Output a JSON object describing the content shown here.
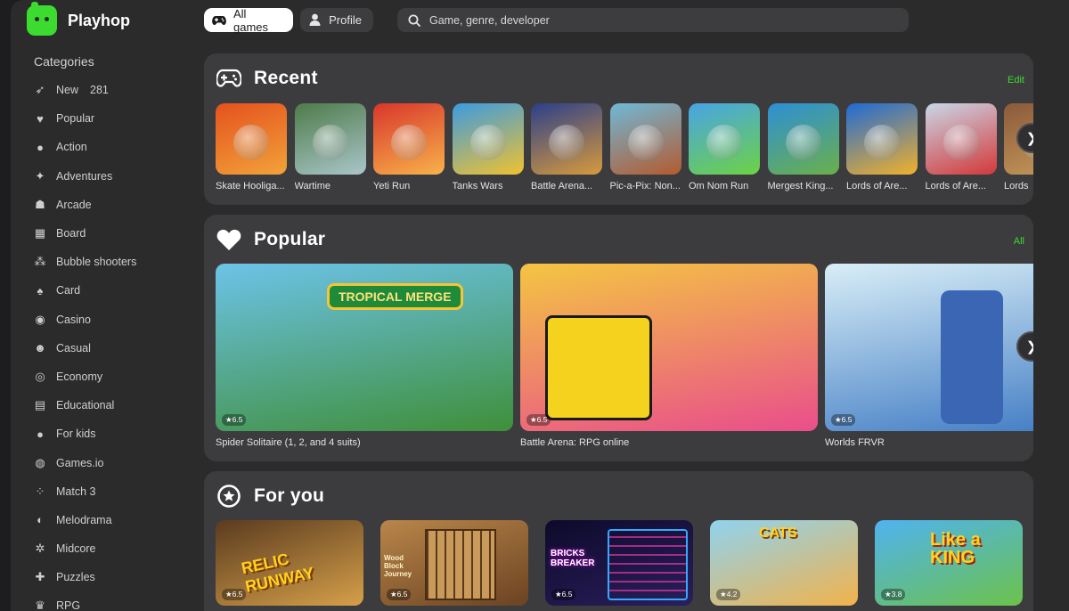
{
  "app": {
    "name": "Playhop"
  },
  "header": {
    "tabs": [
      {
        "label": "All games",
        "icon": "gamepad-icon",
        "active": true
      },
      {
        "label": "Profile",
        "icon": "profile-icon",
        "active": false
      }
    ],
    "search": {
      "placeholder": "Game, genre, developer",
      "icon": "search-icon"
    }
  },
  "sidebar": {
    "title": "Categories",
    "items": [
      {
        "label": "New",
        "count": "281",
        "icon": "rocket-icon"
      },
      {
        "label": "Popular",
        "icon": "heart-icon"
      },
      {
        "label": "Action",
        "icon": "bomb-icon"
      },
      {
        "label": "Adventures",
        "icon": "compass-icon"
      },
      {
        "label": "Arcade",
        "icon": "ghost-icon"
      },
      {
        "label": "Board",
        "icon": "board-icon"
      },
      {
        "label": "Bubble shooters",
        "icon": "bubbles-icon"
      },
      {
        "label": "Card",
        "icon": "spade-icon"
      },
      {
        "label": "Casino",
        "icon": "chip-icon"
      },
      {
        "label": "Casual",
        "icon": "casual-icon"
      },
      {
        "label": "Economy",
        "icon": "coins-icon"
      },
      {
        "label": "Educational",
        "icon": "book-icon"
      },
      {
        "label": "For kids",
        "icon": "balloon-icon"
      },
      {
        "label": "Games.io",
        "icon": "io-icon"
      },
      {
        "label": "Match 3",
        "icon": "match3-icon"
      },
      {
        "label": "Melodrama",
        "icon": "masks-icon"
      },
      {
        "label": "Midcore",
        "icon": "gear-icon"
      },
      {
        "label": "Puzzles",
        "icon": "puzzle-icon"
      },
      {
        "label": "RPG",
        "icon": "crown-icon"
      }
    ]
  },
  "recent": {
    "title": "Recent",
    "action": "Edit",
    "icon": "gamepad-icon",
    "games": [
      {
        "name": "Skate Hooliga...",
        "colors": [
          "#e4521d",
          "#f2a23a"
        ]
      },
      {
        "name": "Wartime",
        "colors": [
          "#4e7b4a",
          "#a9c6c9"
        ]
      },
      {
        "name": "Yeti Run",
        "colors": [
          "#d8362b",
          "#f8b24a"
        ]
      },
      {
        "name": "Tanks Wars",
        "colors": [
          "#3c9be0",
          "#f0c230"
        ]
      },
      {
        "name": "Battle Arena...",
        "colors": [
          "#2b3f8a",
          "#d89a3c"
        ]
      },
      {
        "name": "Pic-a-Pix: Non...",
        "colors": [
          "#6fb9d7",
          "#b45a2f"
        ]
      },
      {
        "name": "Om Nom Run",
        "colors": [
          "#48a4e6",
          "#6dd244"
        ]
      },
      {
        "name": "Mergest King...",
        "colors": [
          "#2d8fd6",
          "#6bb04a"
        ]
      },
      {
        "name": "Lords of Are...",
        "colors": [
          "#1f6ad6",
          "#f1b12b"
        ]
      },
      {
        "name": "Lords of Are...",
        "colors": [
          "#c9d7e8",
          "#d33838"
        ]
      },
      {
        "name": "Lords",
        "colors": [
          "#8a5a3a",
          "#c79b5c"
        ]
      }
    ]
  },
  "popular": {
    "title": "Popular",
    "action": "All",
    "icon": "heart-icon",
    "games": [
      {
        "name": "Spider Solitaire (1, 2, and 4 suits)",
        "rating": "6.5",
        "banner": "TROPICAL MERGE",
        "colors": [
          "#6cc3e8",
          "#3f8f3a"
        ]
      },
      {
        "name": "Battle Arena: RPG online",
        "rating": "6.5",
        "banner": "",
        "colors": [
          "#f4c542",
          "#e94e8b"
        ]
      },
      {
        "name": "Worlds FRVR",
        "rating": "6.5",
        "banner": "",
        "colors": [
          "#d9eef7",
          "#3b78c2"
        ]
      }
    ]
  },
  "for_you": {
    "title": "For you",
    "icon": "star-badge-icon",
    "games": [
      {
        "rating": "6.5",
        "banner": "RELIC RUNWAY",
        "colors": [
          "#5a3b1f",
          "#d6a04a"
        ]
      },
      {
        "rating": "6.5",
        "banner": "Wood Block Journey",
        "colors": [
          "#b9864a",
          "#6b4322"
        ]
      },
      {
        "rating": "6.5",
        "banner": "BRICKS BREAKER",
        "colors": [
          "#0d0a2a",
          "#2a1f5c"
        ]
      },
      {
        "rating": "4.2",
        "banner": "CATS",
        "colors": [
          "#8fd3f0",
          "#f2b24a"
        ]
      },
      {
        "rating": "3.8",
        "banner": "Like a KING",
        "colors": [
          "#4fb3f0",
          "#6cc24a"
        ]
      }
    ]
  },
  "accent": "#3bdc2f"
}
